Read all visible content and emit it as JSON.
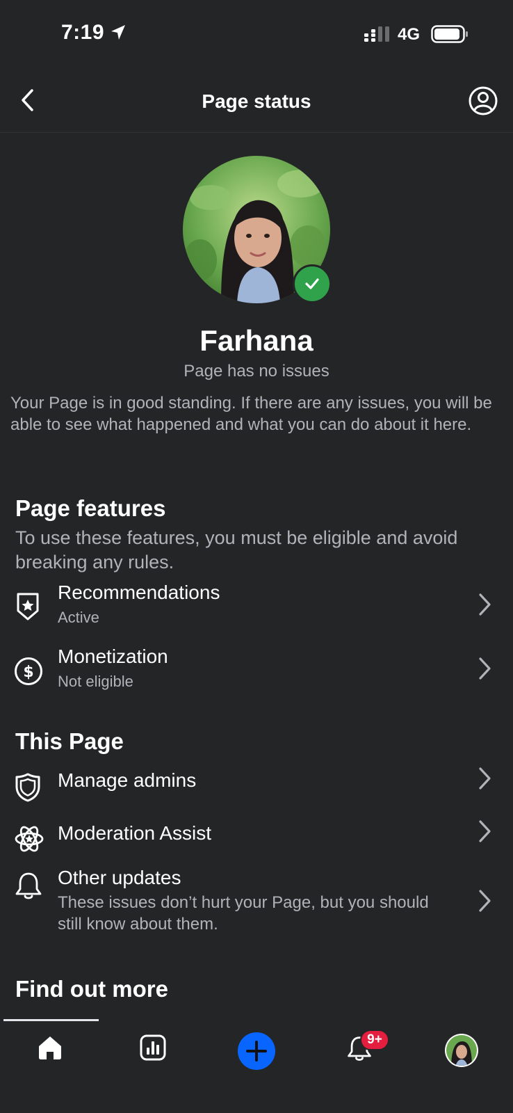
{
  "status_bar": {
    "time": "7:19",
    "network": "4G"
  },
  "header": {
    "title": "Page status"
  },
  "profile": {
    "name": "Farhana",
    "status": "Page has no issues",
    "description": "Your Page is in good standing. If there are any issues, you will be able to see what happened and what you can do about it here."
  },
  "page_features": {
    "title": "Page features",
    "description": "To use these features, you must be eligible and avoid breaking any rules.",
    "items": [
      {
        "title": "Recommendations",
        "status": "Active",
        "icon": "shield-star-icon"
      },
      {
        "title": "Monetization",
        "status": "Not eligible",
        "icon": "dollar-circle-icon"
      }
    ]
  },
  "this_page": {
    "title": "This Page",
    "items": [
      {
        "title": "Manage admins",
        "icon": "shield-icon"
      },
      {
        "title": "Moderation Assist",
        "icon": "atom-icon"
      },
      {
        "title": "Other updates",
        "description": "These issues don’t hurt your Page, but you should still know about them.",
        "icon": "bell-icon"
      }
    ]
  },
  "find_out_more": {
    "title": "Find out more"
  },
  "tab_bar": {
    "tabs": [
      {
        "name": "home",
        "icon": "home-icon"
      },
      {
        "name": "insights",
        "icon": "bar-chart-icon"
      },
      {
        "name": "create",
        "icon": "plus-icon"
      },
      {
        "name": "notifications",
        "icon": "bell-icon"
      },
      {
        "name": "profile",
        "icon": "avatar"
      }
    ],
    "notifications_badge": "9+"
  },
  "colors": {
    "background": "#242527",
    "accent": "#0866ff",
    "verified": "#31a24c",
    "badge": "#e41e3f"
  }
}
